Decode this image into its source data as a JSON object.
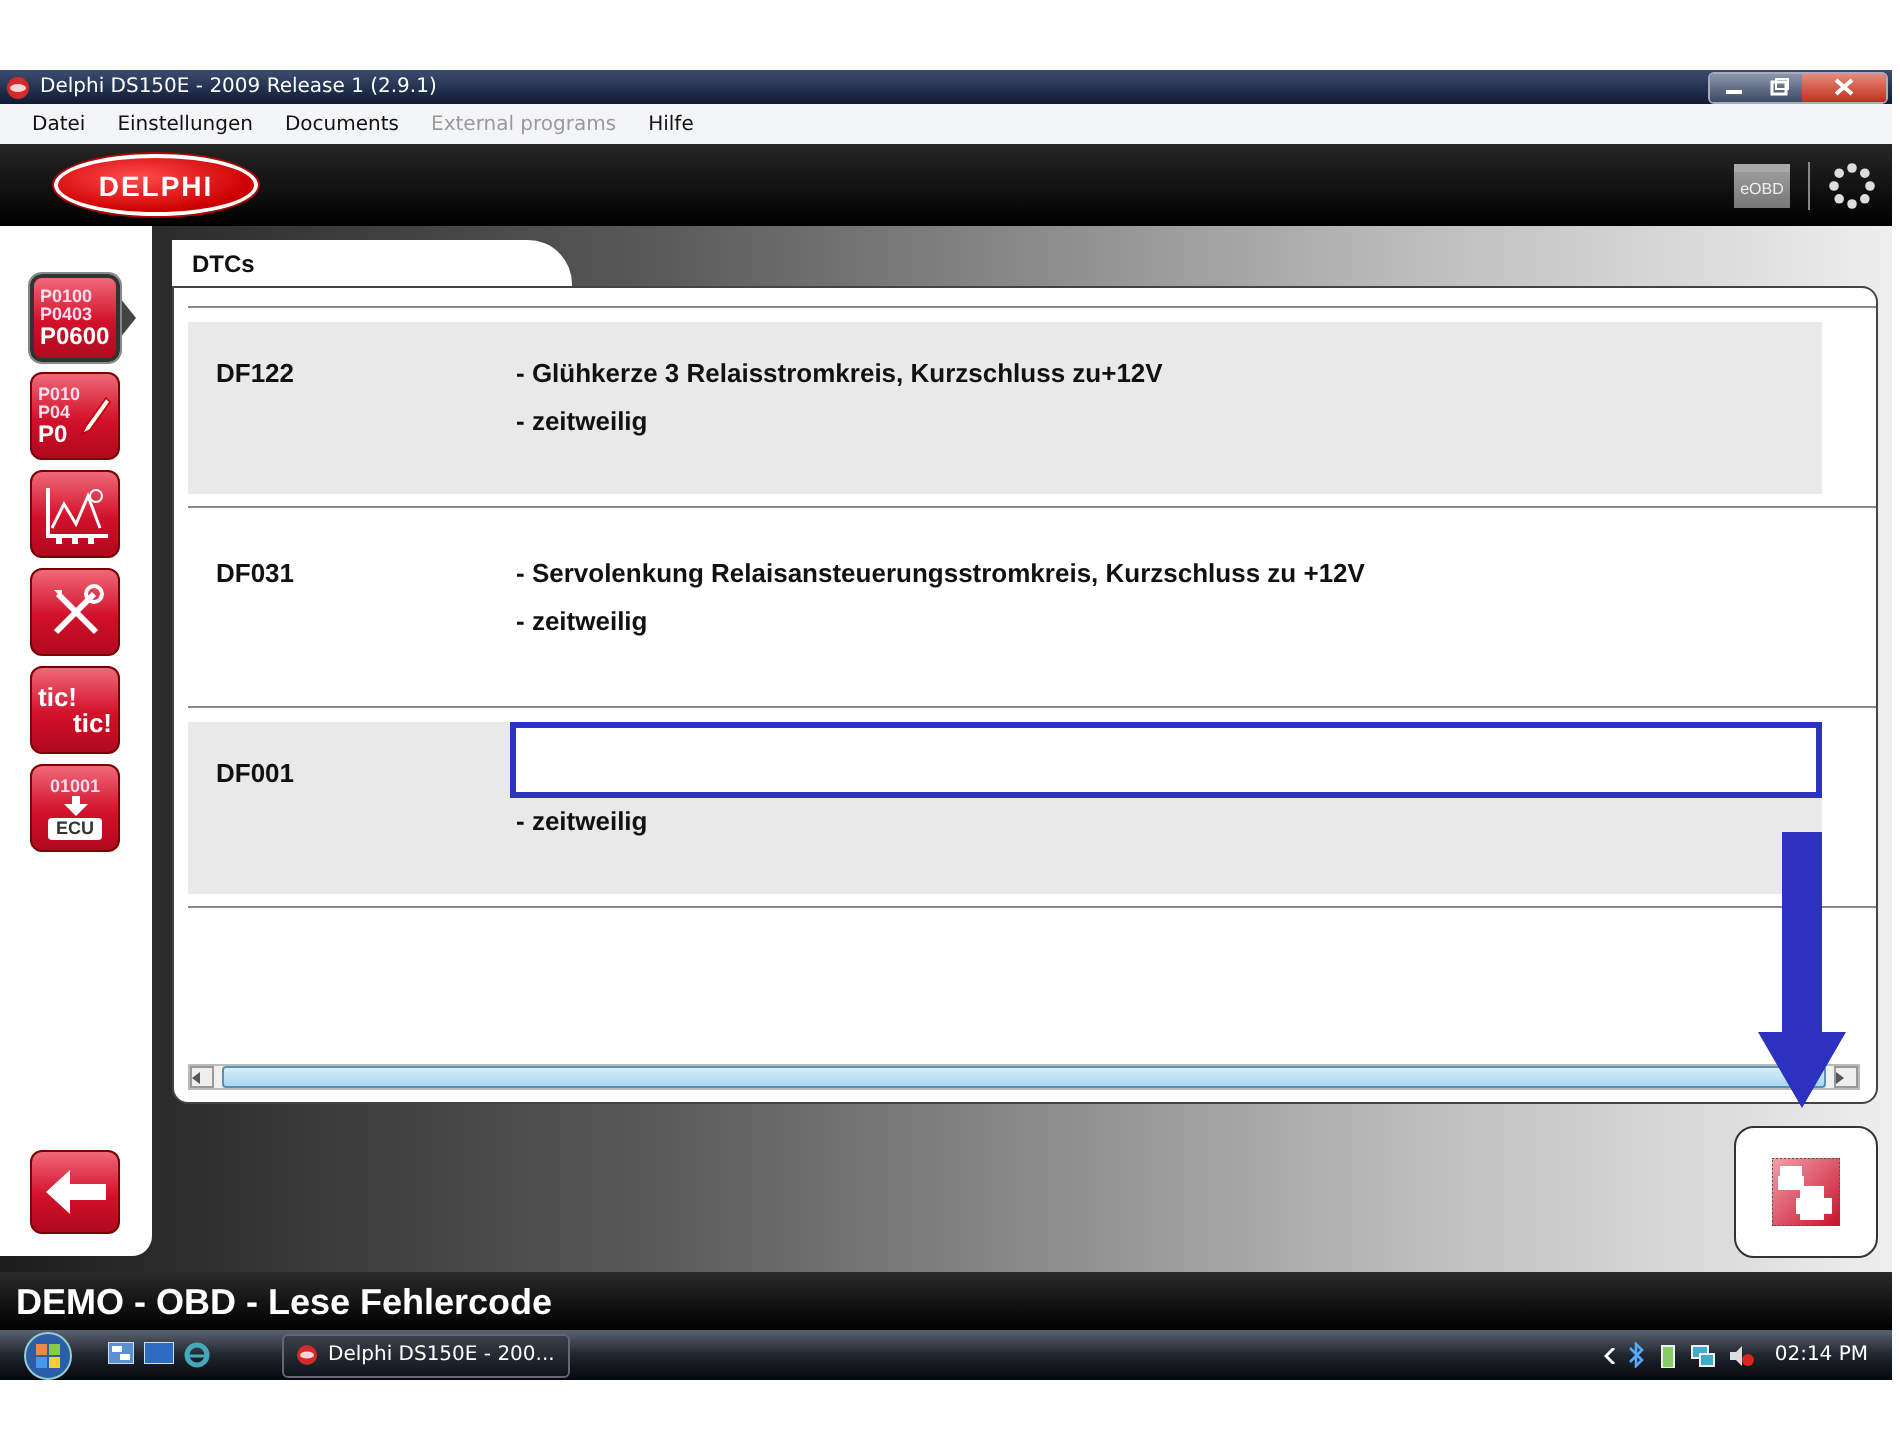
{
  "window": {
    "title": "Delphi DS150E - 2009 Release 1 (2.9.1)"
  },
  "menu": [
    {
      "label": "Datei",
      "disabled": false
    },
    {
      "label": "Einstellungen",
      "disabled": false
    },
    {
      "label": "Documents",
      "disabled": false
    },
    {
      "label": "External programs",
      "disabled": true
    },
    {
      "label": "Hilfe",
      "disabled": false
    }
  ],
  "header": {
    "logo": "DELPHI",
    "badge": "eOBD"
  },
  "sidebar": {
    "items": [
      {
        "kind": "codes",
        "texts": [
          "P0100",
          "P0403",
          "P0600"
        ],
        "selected": true
      },
      {
        "kind": "codes-edit",
        "texts": [
          "P010",
          "P04",
          "P0"
        ],
        "selected": false
      },
      {
        "kind": "chart",
        "selected": false
      },
      {
        "kind": "tools",
        "selected": false
      },
      {
        "kind": "tic",
        "texts": [
          "tic!",
          "tic!"
        ],
        "selected": false
      },
      {
        "kind": "ecu",
        "texts": [
          "01001",
          "ECU"
        ],
        "selected": false
      }
    ]
  },
  "tab": {
    "label": "DTCs"
  },
  "dtcs": [
    {
      "code": "DF122",
      "lines": [
        "- Glühkerze 3 Relaisstromkreis, Kurzschluss zu+12V",
        "- zeitweilig"
      ],
      "framed": false
    },
    {
      "code": "DF031",
      "lines": [
        "- Servolenkung Relaisansteuerungsstromkreis, Kurzschluss zu +12V",
        "- zeitweilig"
      ],
      "framed": false
    },
    {
      "code": "DF001",
      "lines": [
        "- zeitweilig"
      ],
      "framed": true
    }
  ],
  "status_bar": {
    "text": "DEMO - OBD - Lese Fehlercode"
  },
  "taskbar": {
    "task": "Delphi DS150E - 200...",
    "clock": "02:14 PM"
  },
  "annotations": [
    {
      "kind": "arrow"
    }
  ]
}
